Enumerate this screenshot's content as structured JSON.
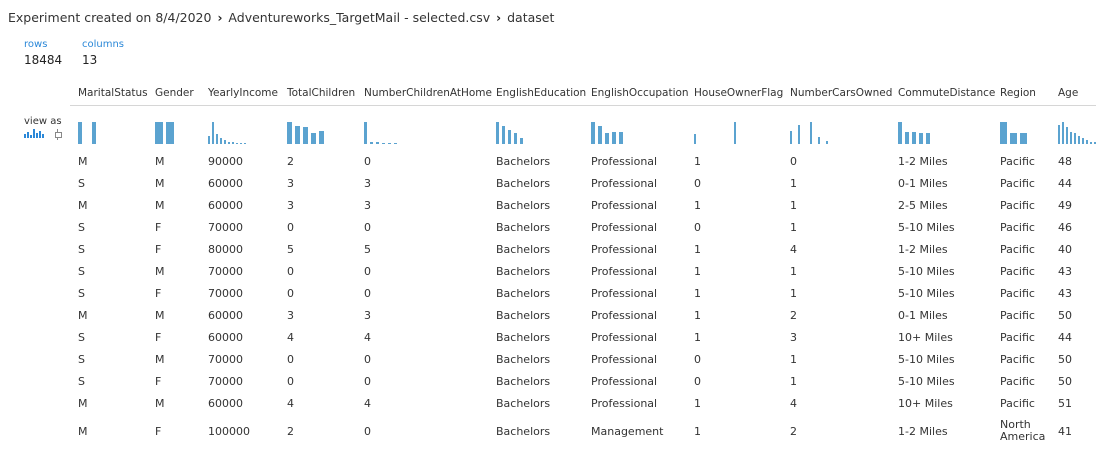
{
  "breadcrumb": [
    "Experiment created on 8/4/2020",
    "Adventureworks_TargetMail - selected.csv",
    "dataset"
  ],
  "stats": {
    "rows_label": "rows",
    "rows_value": "18484",
    "columns_label": "columns",
    "columns_value": "13"
  },
  "view_as": {
    "label": "view as",
    "icons": [
      "histogram-icon",
      "boxplot-icon"
    ]
  },
  "accent_color": "#5ba3d0",
  "columns": [
    "MaritalStatus",
    "Gender",
    "YearlyIncome",
    "TotalChildren",
    "NumberChildrenAtHome",
    "EnglishEducation",
    "EnglishOccupation",
    "HouseOwnerFlag",
    "NumberCarsOwned",
    "CommuteDistance",
    "Region",
    "Age"
  ],
  "rows": [
    [
      "M",
      "M",
      "90000",
      "2",
      "0",
      "Bachelors",
      "Professional",
      "1",
      "0",
      "1-2 Miles",
      "Pacific",
      "48"
    ],
    [
      "S",
      "M",
      "60000",
      "3",
      "3",
      "Bachelors",
      "Professional",
      "0",
      "1",
      "0-1 Miles",
      "Pacific",
      "44"
    ],
    [
      "M",
      "M",
      "60000",
      "3",
      "3",
      "Bachelors",
      "Professional",
      "1",
      "1",
      "2-5 Miles",
      "Pacific",
      "49"
    ],
    [
      "S",
      "F",
      "70000",
      "0",
      "0",
      "Bachelors",
      "Professional",
      "0",
      "1",
      "5-10 Miles",
      "Pacific",
      "46"
    ],
    [
      "S",
      "F",
      "80000",
      "5",
      "5",
      "Bachelors",
      "Professional",
      "1",
      "4",
      "1-2 Miles",
      "Pacific",
      "40"
    ],
    [
      "S",
      "M",
      "70000",
      "0",
      "0",
      "Bachelors",
      "Professional",
      "1",
      "1",
      "5-10 Miles",
      "Pacific",
      "43"
    ],
    [
      "S",
      "F",
      "70000",
      "0",
      "0",
      "Bachelors",
      "Professional",
      "1",
      "1",
      "5-10 Miles",
      "Pacific",
      "43"
    ],
    [
      "M",
      "M",
      "60000",
      "3",
      "3",
      "Bachelors",
      "Professional",
      "1",
      "2",
      "0-1 Miles",
      "Pacific",
      "50"
    ],
    [
      "S",
      "F",
      "60000",
      "4",
      "4",
      "Bachelors",
      "Professional",
      "1",
      "3",
      "10+ Miles",
      "Pacific",
      "44"
    ],
    [
      "S",
      "M",
      "70000",
      "0",
      "0",
      "Bachelors",
      "Professional",
      "0",
      "1",
      "5-10 Miles",
      "Pacific",
      "50"
    ],
    [
      "S",
      "F",
      "70000",
      "0",
      "0",
      "Bachelors",
      "Professional",
      "0",
      "1",
      "5-10 Miles",
      "Pacific",
      "50"
    ],
    [
      "M",
      "M",
      "60000",
      "4",
      "4",
      "Bachelors",
      "Professional",
      "1",
      "4",
      "10+ Miles",
      "Pacific",
      "51"
    ],
    [
      "M",
      "F",
      "100000",
      "2",
      "0",
      "Bachelors",
      "Management",
      "1",
      "2",
      "1-2 Miles",
      "North America",
      "41"
    ]
  ],
  "histograms": [
    [
      0.9,
      0.0,
      0.9
    ],
    [
      0.9,
      0.9
    ],
    [
      0.35,
      0.9,
      0.4,
      0.25,
      0.15,
      0.08,
      0.08,
      0.05,
      0.04,
      0.04
    ],
    [
      0.9,
      0.75,
      0.7,
      0.45,
      0.55
    ],
    [
      0.9,
      0.1,
      0.08,
      0.06,
      0.05,
      0.04
    ],
    [
      0.9,
      0.75,
      0.6,
      0.45,
      0.25
    ],
    [
      0.9,
      0.75,
      0.45,
      0.5,
      0.5
    ],
    [
      0.4,
      0.0,
      0.0,
      0.0,
      0.0,
      0.0,
      0.0,
      0.0,
      0.0,
      0.0,
      0.9
    ],
    [
      0.55,
      0.0,
      0.8,
      0.0,
      0.0,
      0.9,
      0.0,
      0.3,
      0.0,
      0.12
    ],
    [
      0.9,
      0.5,
      0.5,
      0.45,
      0.45
    ],
    [
      0.9,
      0.45,
      0.45
    ],
    [
      0.8,
      0.9,
      0.7,
      0.5,
      0.45,
      0.35,
      0.25,
      0.15,
      0.1,
      0.08,
      0.05
    ]
  ]
}
